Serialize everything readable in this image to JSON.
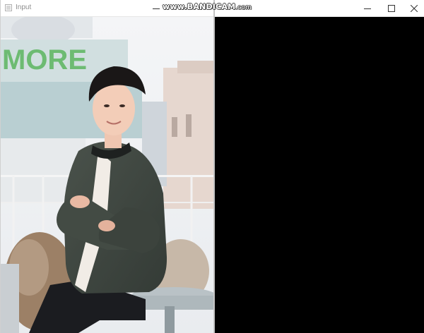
{
  "screen": {
    "watermark_main": "www.BANDICAM",
    "watermark_suffix": ".com"
  },
  "left_window": {
    "title": "Input",
    "controls": {
      "minimize": "minimize-icon",
      "maximize": "maximize-icon",
      "close": "close-icon"
    },
    "image": {
      "sign_text": "MORE",
      "description_icon": "photo-icon"
    }
  },
  "right_window": {
    "title": "",
    "controls": {
      "minimize": "minimize-icon",
      "maximize": "maximize-icon",
      "close": "close-icon"
    },
    "canvas_color": "#000000"
  },
  "colors": {
    "titlebar_bg": "#ffffff",
    "title_text": "#8e8e8e",
    "output_canvas": "#000000",
    "sign_green": "#6dbb72"
  }
}
